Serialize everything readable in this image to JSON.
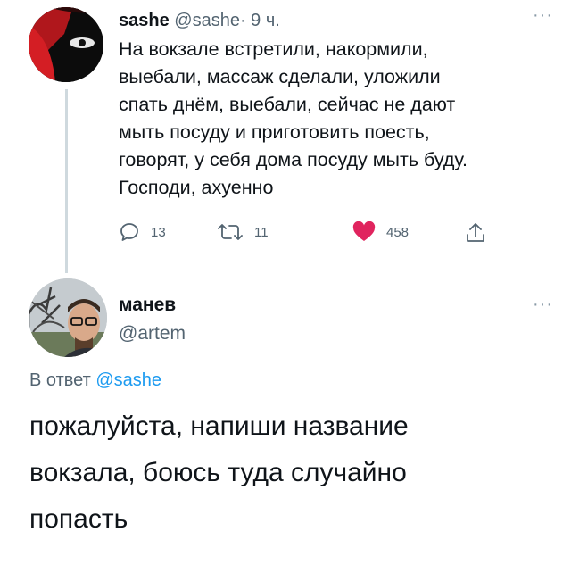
{
  "tweet": {
    "author_name": "sashe",
    "author_handle": "@sashe",
    "time": "· 9 ч.",
    "more": "···",
    "text": "На вокзале встретили, накормили,\nвыебали, массаж сделали, уложили\nспать днём, выебали, сейчас не дают\nмыть посуду и приготовить поесть,\nговорят, у себя дома посуду мыть буду.\nГосподи, ахуенно",
    "replies": "13",
    "retweets": "11",
    "likes": "458",
    "like_color": "#e0245e"
  },
  "reply": {
    "author_name": "манев",
    "author_handle": "@artem",
    "more": "···",
    "reply_prefix": "В ответ",
    "reply_mention": "@sashe",
    "text": "пожалуйста, напиши название\nвокзала, боюсь туда случайно\nпопасть",
    "mention_color": "#1d9bf0"
  },
  "icons": {
    "reply": "reply-icon",
    "retweet": "retweet-icon",
    "like": "heart-icon",
    "share": "share-icon"
  }
}
